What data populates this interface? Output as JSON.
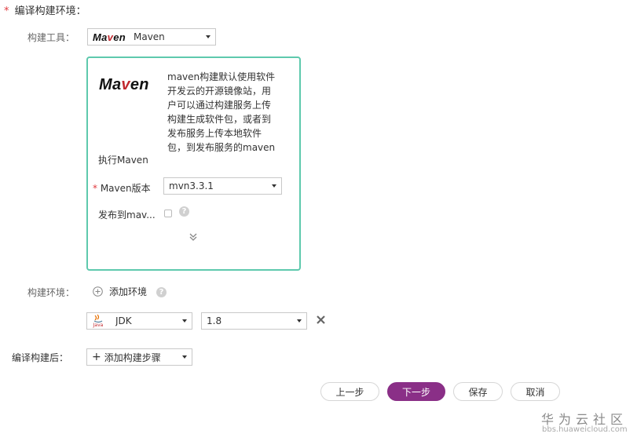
{
  "section": {
    "required_mark": "*",
    "title": "编译构建环境："
  },
  "build_tool": {
    "label": "构建工具：",
    "logo": "Maven",
    "value": "Maven"
  },
  "card": {
    "logo": "Maven",
    "description_lines": [
      "maven构建默认使用软件",
      "开发云的开源镜像站，用",
      "户可以通过构建服务上传",
      "构建生成软件包，或者到",
      "发布服务上传本地软件",
      "包，到发布服务的maven"
    ],
    "exec_text": "执行Maven",
    "version_required_mark": "*",
    "version_label": "Maven版本",
    "version_value": "mvn3.3.1",
    "publish_label": "发布到mav...",
    "help_glyph": "?",
    "expand_icon": "double-chevron-down-icon"
  },
  "build_env": {
    "label": "构建环境：",
    "add_label": "添加环境",
    "help_glyph": "?",
    "jdk_icon": "java-icon",
    "jdk_logo_text": "Java",
    "env_value": "JDK",
    "version_value": "1.8",
    "remove_icon": "close-icon"
  },
  "post_build": {
    "label": "编译构建后：",
    "add_step_label": "添加构建步骤"
  },
  "buttons": {
    "prev": "上一步",
    "next": "下一步",
    "save": "保存",
    "cancel": "取消"
  },
  "watermark": {
    "brand": "华为云社区",
    "url": "bbs.huaweicloud.com"
  },
  "colors": {
    "card_border": "#5ec9ad",
    "primary_button": "#8a2f87",
    "required": "#e0393e"
  }
}
